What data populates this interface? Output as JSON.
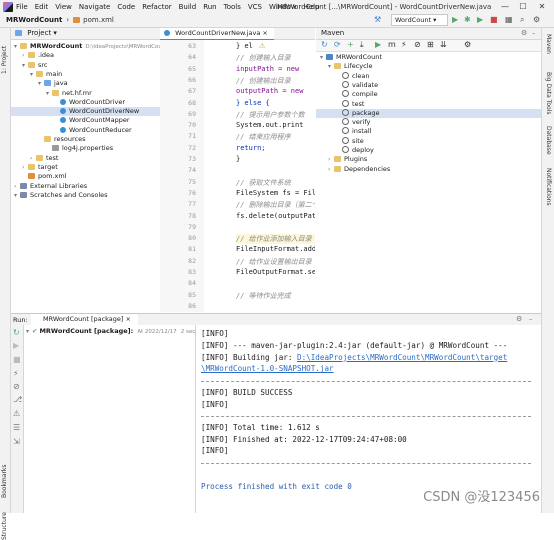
{
  "menu": {
    "items": [
      "File",
      "Edit",
      "View",
      "Navigate",
      "Code",
      "Refactor",
      "Build",
      "Run",
      "Tools",
      "VCS",
      "Window",
      "Help"
    ],
    "window_title": "MRWordCount [...\\MRWordCount] - WordCountDriverNew.java",
    "window_controls": [
      "—",
      "☐",
      "✕"
    ]
  },
  "nav": {
    "project": "MRWordCount",
    "file": "pom.xml",
    "run_config": "WordCount ▾"
  },
  "left_strip": {
    "project_label": "1: Project",
    "bookmarks_label": "Bookmarks",
    "structure_label": "Structure"
  },
  "right_strip": {
    "labels": [
      "Maven",
      "Big Data Tools",
      "Database",
      "Notifications"
    ]
  },
  "project_panel": {
    "title": "Project ▾",
    "tree": [
      {
        "label": "MRWordCount",
        "suffix": "D:\\IdeaProjects\\MRWordCount",
        "indent": 0,
        "icon": "folder"
      },
      {
        "label": ".idea",
        "indent": 1,
        "icon": "folder"
      },
      {
        "label": "src",
        "indent": 1,
        "icon": "folder"
      },
      {
        "label": "main",
        "indent": 2,
        "icon": "folder"
      },
      {
        "label": "java",
        "indent": 3,
        "icon": "folder-blue"
      },
      {
        "label": "net.hf.mr",
        "indent": 4,
        "icon": "folder"
      },
      {
        "label": "WordCountDriver",
        "indent": 5,
        "icon": "class"
      },
      {
        "label": "WordCountDriverNew",
        "indent": 5,
        "icon": "class",
        "selected": true
      },
      {
        "label": "WordCountMapper",
        "indent": 5,
        "icon": "class"
      },
      {
        "label": "WordCountReducer",
        "indent": 5,
        "icon": "class"
      },
      {
        "label": "resources",
        "indent": 3,
        "icon": "folder"
      },
      {
        "label": "log4j.properties",
        "indent": 4,
        "icon": "properties"
      },
      {
        "label": "test",
        "indent": 2,
        "icon": "folder"
      },
      {
        "label": "target",
        "indent": 1,
        "icon": "folder"
      },
      {
        "label": "pom.xml",
        "indent": 1,
        "icon": "xml"
      },
      {
        "label": "External Libraries",
        "indent": 0,
        "icon": "library"
      },
      {
        "label": "Scratches and Consoles",
        "indent": 0,
        "icon": "scratch"
      }
    ]
  },
  "editor": {
    "tab": "WordCountDriverNew.java ×",
    "line_numbers": [
      "63",
      "64",
      "65",
      "66",
      "67",
      "68",
      "69",
      "70",
      "71",
      "72",
      "73",
      "74",
      "75",
      "76",
      "77",
      "78",
      "79",
      "80",
      "81",
      "82",
      "83",
      "84",
      "85",
      "86"
    ],
    "lines": [
      {
        "text": "} el",
        "cls": ""
      },
      {
        "text": "    // 创建输入目录",
        "cls": "cm"
      },
      {
        "text": "    inputPath = new",
        "cls": "vr"
      },
      {
        "text": "    // 创建输出目录",
        "cls": "cm"
      },
      {
        "text": "    outputPath = new",
        "cls": "vr"
      },
      {
        "text": "} else {",
        "cls": "kw"
      },
      {
        "text": "    // 提示用户参数个数",
        "cls": "cm"
      },
      {
        "text": "    System.out.print",
        "cls": ""
      },
      {
        "text": "    // 结束应用程序",
        "cls": "cm"
      },
      {
        "text": "    return;",
        "cls": "kw"
      },
      {
        "text": "}",
        "cls": ""
      },
      {
        "text": "",
        "cls": ""
      },
      {
        "text": "// 获取文件系统",
        "cls": "cm"
      },
      {
        "text": "FileSystem fs = File",
        "cls": ""
      },
      {
        "text": "// 删除输出目录（第二个",
        "cls": "cm"
      },
      {
        "text": "fs.delete(outputPath",
        "cls": ""
      },
      {
        "text": "",
        "cls": ""
      },
      {
        "text": "// 给作业添加输入目录（",
        "cls": "cm"
      },
      {
        "text": "FileInputFormat.add",
        "cls": ""
      },
      {
        "text": "// 给作业设置输出目录（",
        "cls": "cm"
      },
      {
        "text": "FileOutputFormat.set",
        "cls": ""
      },
      {
        "text": "",
        "cls": ""
      },
      {
        "text": "// 等待作业完成",
        "cls": "cm"
      },
      {
        "text": "",
        "cls": ""
      }
    ]
  },
  "maven": {
    "title": "Maven",
    "tree": [
      {
        "label": "MRWordCount",
        "indent": 0,
        "icon": "maven"
      },
      {
        "label": "Lifecycle",
        "indent": 1,
        "icon": "folder"
      },
      {
        "label": "clean",
        "indent": 2,
        "icon": "gear"
      },
      {
        "label": "validate",
        "indent": 2,
        "icon": "gear"
      },
      {
        "label": "compile",
        "indent": 2,
        "icon": "gear"
      },
      {
        "label": "test",
        "indent": 2,
        "icon": "gear"
      },
      {
        "label": "package",
        "indent": 2,
        "icon": "gear",
        "selected": true
      },
      {
        "label": "verify",
        "indent": 2,
        "icon": "gear"
      },
      {
        "label": "install",
        "indent": 2,
        "icon": "gear"
      },
      {
        "label": "site",
        "indent": 2,
        "icon": "gear"
      },
      {
        "label": "deploy",
        "indent": 2,
        "icon": "gear"
      },
      {
        "label": "Plugins",
        "indent": 1,
        "icon": "folder"
      },
      {
        "label": "Dependencies",
        "indent": 1,
        "icon": "folder"
      }
    ]
  },
  "run": {
    "label": "Run:",
    "tab": "MRWordCount [package] ×",
    "tree_item": "MRWordCount [package]:",
    "tree_time": "At 2022/12/17",
    "tree_duration": "2 sec, 489 ms",
    "console": [
      {
        "text": "[INFO]",
        "type": "plain"
      },
      {
        "text": "[INFO] --- maven-jar-plugin:2.4:jar (default-jar) @ MRWordCount ---",
        "type": "plain"
      },
      {
        "text": "[INFO] Building jar: ",
        "link": "D:\\IdeaProjects\\MRWordCount\\MRWordCount\\target",
        "type": "link"
      },
      {
        "text": "",
        "link": "\\MRWordCount-1.0-SNAPSHOT.jar",
        "type": "link"
      },
      {
        "text": "",
        "type": "sep"
      },
      {
        "text": "[INFO] BUILD SUCCESS",
        "type": "plain"
      },
      {
        "text": "[INFO]",
        "type": "plain"
      },
      {
        "text": "",
        "type": "sep"
      },
      {
        "text": "[INFO] Total time:  1.612 s",
        "type": "plain"
      },
      {
        "text": "[INFO] Finished at: 2022-12-17T09:24:47+08:00",
        "type": "plain"
      },
      {
        "text": "[INFO]",
        "type": "plain"
      },
      {
        "text": "",
        "type": "sep"
      },
      {
        "text": "",
        "type": "plain"
      },
      {
        "text": "Process finished with exit code 0",
        "type": "finish"
      }
    ]
  },
  "watermark": "CSDN @没123456",
  "colors": {
    "accent": "#4a86c8",
    "selection": "#d5e1f2",
    "success": "#59a869",
    "link": "#2a6cc7"
  }
}
